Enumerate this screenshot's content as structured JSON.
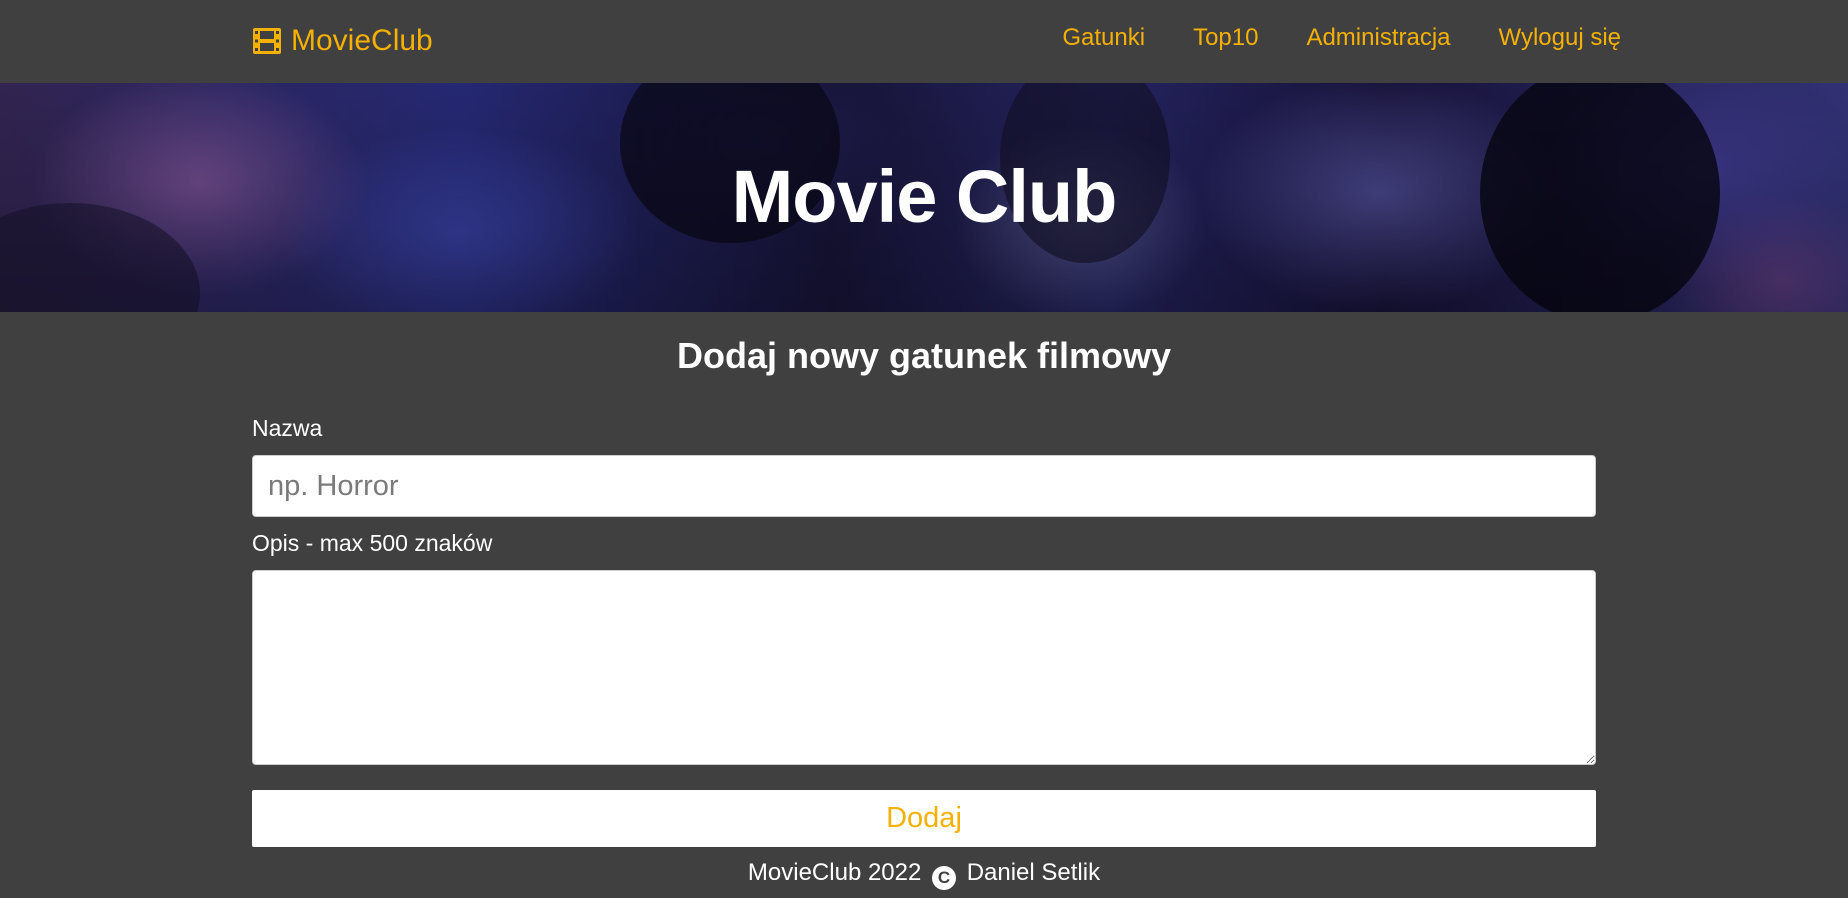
{
  "navbar": {
    "brand": "MovieClub",
    "brand_icon": "film-icon",
    "links": [
      {
        "label": "Gatunki"
      },
      {
        "label": "Top10"
      },
      {
        "label": "Administracja"
      },
      {
        "label": "Wyloguj się"
      }
    ]
  },
  "hero": {
    "title": "Movie Club"
  },
  "form": {
    "title": "Dodaj nowy gatunek filmowy",
    "name_label": "Nazwa",
    "name_placeholder": "np. Horror",
    "name_value": "",
    "description_label": "Opis - max 500 znaków",
    "description_value": "",
    "submit_label": "Dodaj"
  },
  "footer": {
    "left_text": "MovieClub 2022",
    "copyright_symbol": "C",
    "author": "Daniel Setlik"
  },
  "colors": {
    "background": "#404040",
    "accent": "#f5b100",
    "text": "#ffffff"
  }
}
